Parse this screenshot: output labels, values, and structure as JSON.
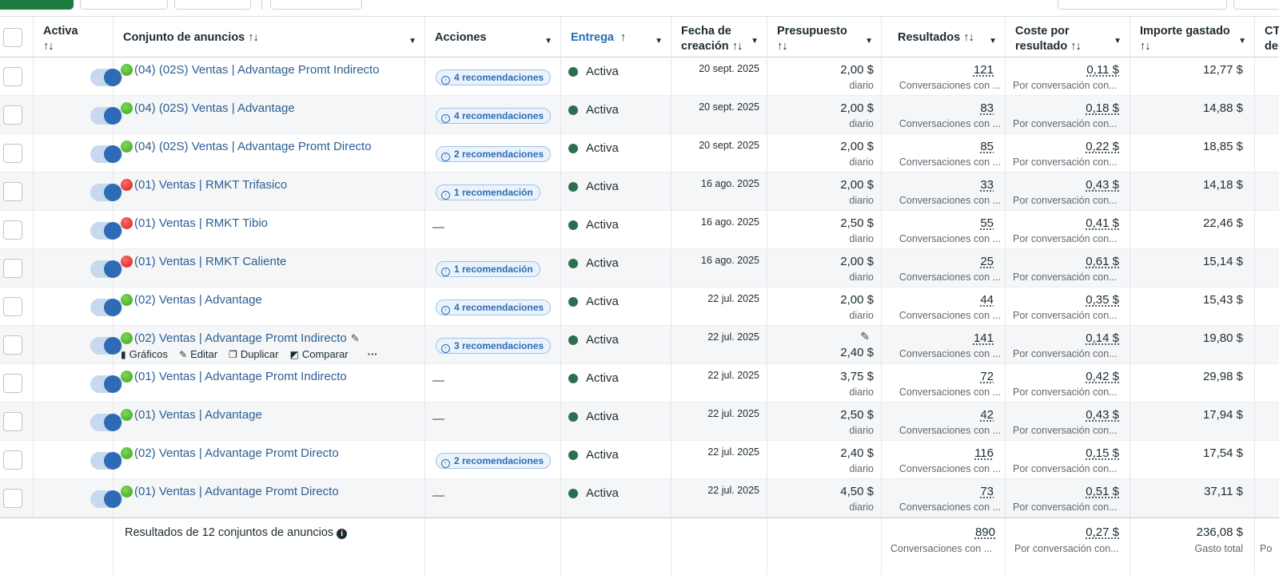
{
  "columns": {
    "active": "Activa",
    "adset": "Conjunto de anuncios",
    "actions": "Acciones",
    "delivery": "Entrega",
    "created_line1": "Fecha de",
    "created_line2": "creación",
    "budget": "Presupuesto",
    "results": "Resultados",
    "cost_line1": "Coste por",
    "cost_line2": "resultado",
    "spent": "Importe gastado",
    "ctr_line1": "CT",
    "ctr_line2": "de",
    "sort_glyph": "↑↓",
    "asc_glyph": "↑"
  },
  "colors": {
    "link": "#2d5e94",
    "accent": "#2d6bb5",
    "active_dot": "#2c6e4f",
    "primary_button": "#1e7b40"
  },
  "hover_actions": {
    "charts": "Gráficos",
    "edit": "Editar",
    "duplicate": "Duplicar",
    "compare": "Comparar",
    "more": "···"
  },
  "rows": [
    {
      "name": "(04) (02S) Ventas | Advantage Promt Indirecto",
      "dot": "green",
      "reco": "4 recomendaciones",
      "status": "Activa",
      "date": "20 sept. 2025",
      "budget": "2,00 $",
      "budget_sub": "diario",
      "results": "121",
      "results_sub": "Conversaciones con ...",
      "cost": "0,11 $",
      "cost_sub": "Por conversación con...",
      "spent": "12,77 $"
    },
    {
      "name": "(04) (02S) Ventas | Advantage",
      "dot": "green",
      "reco": "4 recomendaciones",
      "status": "Activa",
      "date": "20 sept. 2025",
      "budget": "2,00 $",
      "budget_sub": "diario",
      "results": "83",
      "results_sub": "Conversaciones con ...",
      "cost": "0,18 $",
      "cost_sub": "Por conversación con...",
      "spent": "14,88 $"
    },
    {
      "name": "(04) (02S) Ventas | Advantage Promt Directo",
      "dot": "green",
      "reco": "2 recomendaciones",
      "status": "Activa",
      "date": "20 sept. 2025",
      "budget": "2,00 $",
      "budget_sub": "diario",
      "results": "85",
      "results_sub": "Conversaciones con ...",
      "cost": "0,22 $",
      "cost_sub": "Por conversación con...",
      "spent": "18,85 $"
    },
    {
      "name": " (01) Ventas | RMKT Trifasico",
      "dot": "red",
      "reco": "1 recomendación",
      "status": "Activa",
      "date": "16 ago. 2025",
      "budget": "2,00 $",
      "budget_sub": "diario",
      "results": "33",
      "results_sub": "Conversaciones con ...",
      "cost": "0,43 $",
      "cost_sub": "Por conversación con...",
      "spent": "14,18 $"
    },
    {
      "name": " (01) Ventas | RMKT Tibio",
      "dot": "red",
      "reco": "",
      "status": "Activa",
      "date": "16 ago. 2025",
      "budget": "2,50 $",
      "budget_sub": "diario",
      "results": "55",
      "results_sub": "Conversaciones con ...",
      "cost": "0,41 $",
      "cost_sub": "Por conversación con...",
      "spent": "22,46 $"
    },
    {
      "name": " (01) Ventas | RMKT Caliente",
      "dot": "red",
      "reco": "1 recomendación",
      "status": "Activa",
      "date": "16 ago. 2025",
      "budget": "2,00 $",
      "budget_sub": "diario",
      "results": "25",
      "results_sub": "Conversaciones con ...",
      "cost": "0,61 $",
      "cost_sub": "Por conversación con...",
      "spent": "15,14 $"
    },
    {
      "name": "(02) Ventas | Advantage",
      "dot": "green",
      "reco": "4 recomendaciones",
      "status": "Activa",
      "date": "22 jul. 2025",
      "budget": "2,00 $",
      "budget_sub": "diario",
      "results": "44",
      "results_sub": "Conversaciones con ...",
      "cost": "0,35 $",
      "cost_sub": "Por conversación con...",
      "spent": "15,43 $"
    },
    {
      "name": "(02) Ventas | Advantage Promt Indirecto",
      "dot": "green",
      "reco": "3 recomendaciones",
      "status": "Activa",
      "date": "22 jul. 2025",
      "budget": "2,40 $",
      "budget_sub": "",
      "results": "141",
      "results_sub": "Conversaciones con ...",
      "cost": "0,14 $",
      "cost_sub": "Por conversación con...",
      "spent": "19,80 $",
      "hover": true
    },
    {
      "name": "(01) Ventas | Advantage Promt Indirecto",
      "dot": "green",
      "reco": "",
      "status": "Activa",
      "date": "22 jul. 2025",
      "budget": "3,75 $",
      "budget_sub": "diario",
      "results": "72",
      "results_sub": "Conversaciones con ...",
      "cost": "0,42 $",
      "cost_sub": "Por conversación con...",
      "spent": "29,98 $"
    },
    {
      "name": "(01) Ventas | Advantage",
      "dot": "green",
      "reco": "",
      "status": "Activa",
      "date": "22 jul. 2025",
      "budget": "2,50 $",
      "budget_sub": "diario",
      "results": "42",
      "results_sub": "Conversaciones con ...",
      "cost": "0,43 $",
      "cost_sub": "Por conversación con...",
      "spent": "17,94 $"
    },
    {
      "name": "(02) Ventas | Advantage Promt Directo",
      "dot": "green",
      "reco": "2 recomendaciones",
      "status": "Activa",
      "date": "22 jul. 2025",
      "budget": "2,40 $",
      "budget_sub": "diario",
      "results": "116",
      "results_sub": "Conversaciones con ...",
      "cost": "0,15 $",
      "cost_sub": "Por conversación con...",
      "spent": "17,54 $"
    },
    {
      "name": "(01) Ventas | Advantage Promt Directo",
      "dot": "green",
      "reco": "",
      "status": "Activa",
      "date": "22 jul. 2025",
      "budget": "4,50 $",
      "budget_sub": "diario",
      "results": "73",
      "results_sub": "Conversaciones con ...",
      "cost": "0,51 $",
      "cost_sub": "Por conversación con...",
      "spent": "37,11 $"
    }
  ],
  "footer": {
    "label": "Resultados de 12 conjuntos de anuncios",
    "results": "890",
    "results_sub": "Conversaciones con ...",
    "cost": "0,27 $",
    "cost_sub": "Por conversación con...",
    "spent": "236,08 $",
    "spent_sub": "Gasto total",
    "ctr_sub": "Po"
  }
}
